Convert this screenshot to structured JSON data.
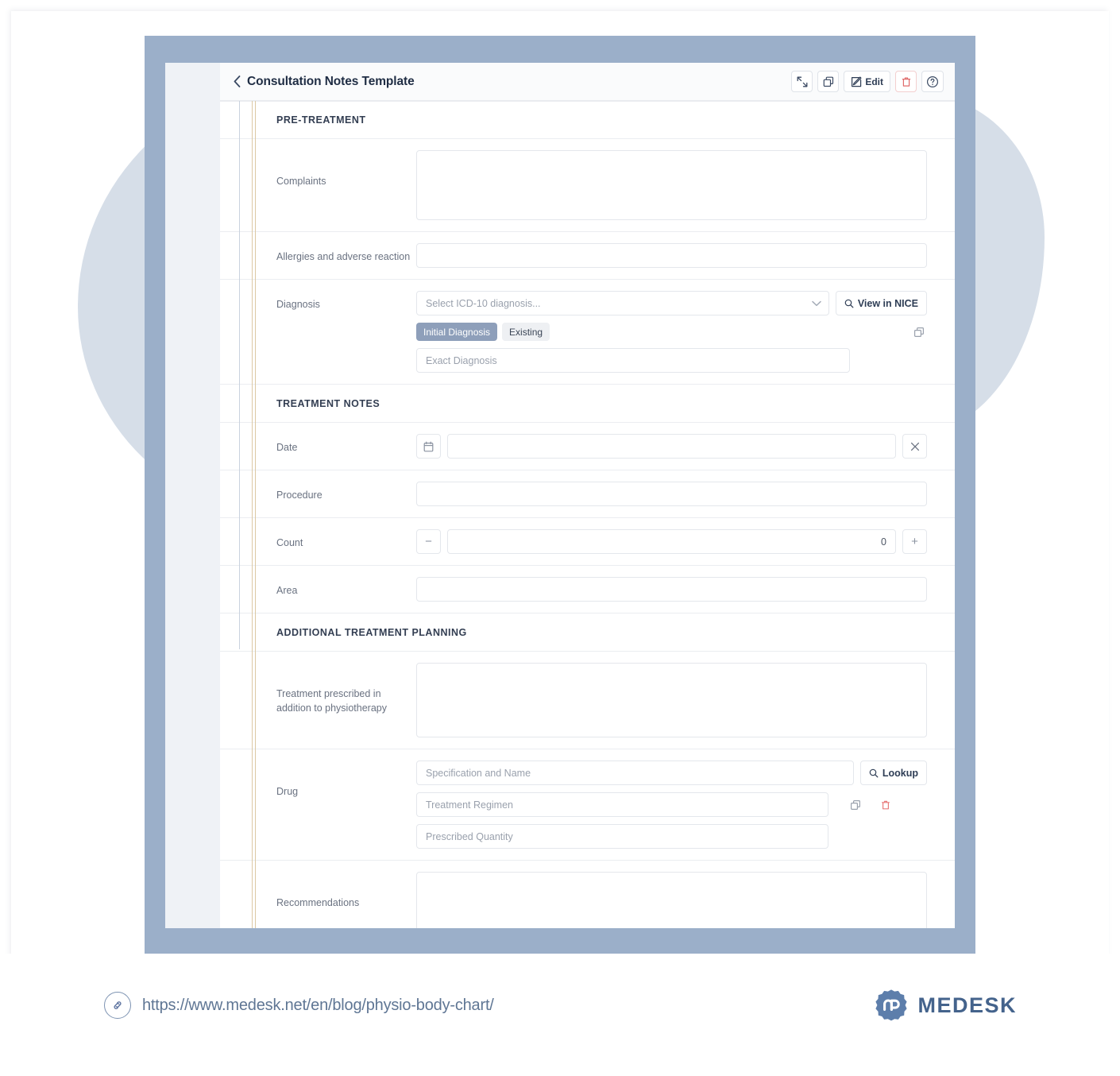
{
  "header": {
    "title": "Consultation Notes Template",
    "back_icon": "chevron-left-icon",
    "actions": {
      "expand_label": "",
      "duplicate_label": "",
      "edit_label": "Edit",
      "delete_label": "",
      "help_label": ""
    }
  },
  "sections": {
    "pre_treatment": {
      "title": "PRE-TREATMENT",
      "rows": {
        "complaints": {
          "label": "Complaints",
          "value": ""
        },
        "allergies": {
          "label": "Allergies and adverse reaction",
          "value": ""
        },
        "diagnosis": {
          "label": "Diagnosis",
          "select_placeholder": "Select ICD-10 diagnosis...",
          "nice_button": "View in NICE",
          "tags": [
            {
              "label": "Initial Diagnosis",
              "selected": true
            },
            {
              "label": "Existing",
              "selected": false
            }
          ],
          "exact_placeholder": "Exact Diagnosis"
        }
      }
    },
    "treatment_notes": {
      "title": "TREATMENT NOTES",
      "rows": {
        "date": {
          "label": "Date",
          "value": ""
        },
        "procedure": {
          "label": "Procedure",
          "value": ""
        },
        "count": {
          "label": "Count",
          "value": "0",
          "minus": "−",
          "plus": "+"
        },
        "area": {
          "label": "Area",
          "value": ""
        }
      }
    },
    "additional_planning": {
      "title": "ADDITIONAL TREATMENT PLANNING",
      "rows": {
        "treatment_prescribed": {
          "label": "Treatment prescribed in addition to physiotherapy",
          "value": ""
        },
        "drug": {
          "label": "Drug",
          "spec_placeholder": "Specification and Name",
          "lookup_button": "Lookup",
          "regimen_placeholder": "Treatment Regimen",
          "quantity_placeholder": "Prescribed Quantity"
        },
        "recommendations": {
          "label": "Recommendations",
          "value": ""
        }
      }
    }
  },
  "footer": {
    "url": "https://www.medesk.net/en/blog/physio-body-chart/",
    "brand": "MEDESK"
  },
  "colors": {
    "frame": "#9bafc9",
    "blob": "#d6dee8",
    "accent_tan": "#dcc9a4",
    "tag_selected": "#8e9fba",
    "danger": "#e06b6b",
    "brand": "#44638c"
  }
}
